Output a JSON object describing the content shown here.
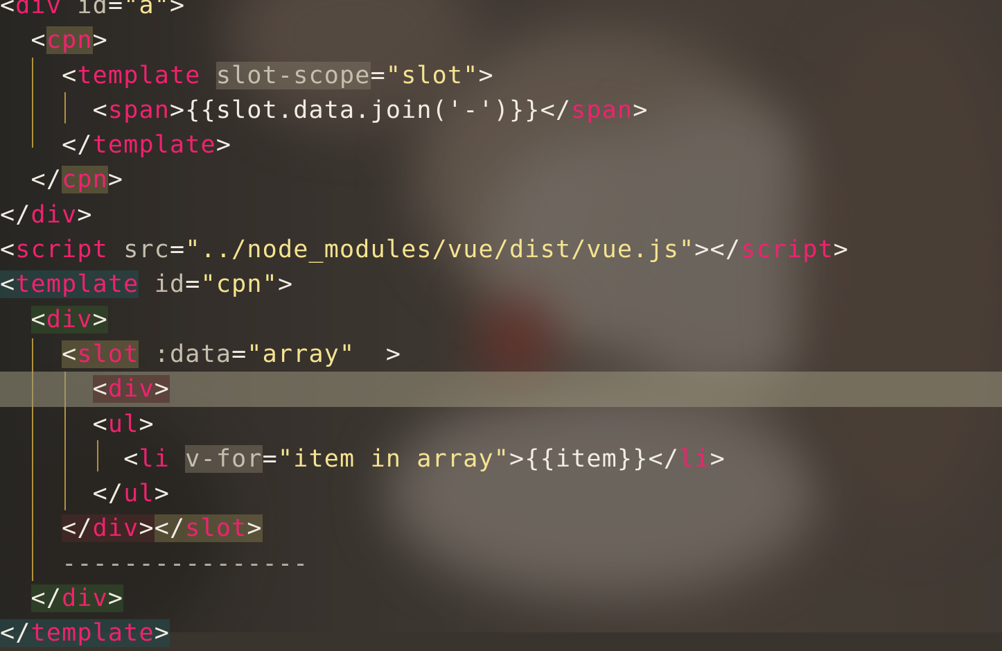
{
  "code_lines": [
    {
      "indent": "",
      "parts": [
        [
          "t",
          "<"
        ],
        [
          "tg",
          "div"
        ],
        [
          "t",
          " "
        ],
        [
          "at",
          "id"
        ],
        [
          "t",
          "="
        ],
        [
          "st",
          "\"a\""
        ],
        [
          "t",
          ">"
        ]
      ]
    },
    {
      "indent": "  ",
      "parts": [
        [
          "t",
          "<"
        ],
        [
          "tg hl-y",
          "cpn"
        ],
        [
          "t",
          ">"
        ]
      ]
    },
    {
      "indent": "    ",
      "parts": [
        [
          "t",
          "<"
        ],
        [
          "tg",
          "template"
        ],
        [
          "t",
          " "
        ],
        [
          "at hl-attr",
          "slot-scope"
        ],
        [
          "t",
          "="
        ],
        [
          "st",
          "\"slot\""
        ],
        [
          "t",
          ">"
        ]
      ]
    },
    {
      "indent": "      ",
      "parts": [
        [
          "t",
          "<"
        ],
        [
          "tg",
          "span"
        ],
        [
          "t",
          ">"
        ],
        [
          "tx",
          "{{slot.data.join('-')}}"
        ],
        [
          "t",
          "</"
        ],
        [
          "tg",
          "span"
        ],
        [
          "t",
          ">"
        ]
      ]
    },
    {
      "indent": "    ",
      "parts": [
        [
          "t",
          "</"
        ],
        [
          "tg",
          "template"
        ],
        [
          "t",
          ">"
        ]
      ]
    },
    {
      "indent": "  ",
      "parts": [
        [
          "t",
          "</"
        ],
        [
          "tg hl-y",
          "cpn"
        ],
        [
          "t",
          ">"
        ]
      ]
    },
    {
      "indent": "",
      "parts": [
        [
          "t",
          "</"
        ],
        [
          "tg",
          "div"
        ],
        [
          "t",
          ">"
        ]
      ]
    },
    {
      "indent": "",
      "parts": [
        [
          "t",
          "<"
        ],
        [
          "tg",
          "script"
        ],
        [
          "t",
          " "
        ],
        [
          "at",
          "src"
        ],
        [
          "t",
          "="
        ],
        [
          "st",
          "\"../node_modules/vue/dist/vue.js\""
        ],
        [
          "t",
          "></"
        ],
        [
          "tg",
          "script"
        ],
        [
          "t",
          ">"
        ]
      ]
    },
    {
      "indent": "",
      "parts": [
        [
          "t hl-teal",
          "<"
        ],
        [
          "tg hl-teal",
          "template"
        ],
        [
          "t",
          " "
        ],
        [
          "at",
          "id"
        ],
        [
          "t",
          "="
        ],
        [
          "st",
          "\"cpn\""
        ],
        [
          "t",
          ">"
        ]
      ]
    },
    {
      "indent": "  ",
      "parts": [
        [
          "t hl-green",
          "<"
        ],
        [
          "tg hl-green",
          "div"
        ],
        [
          "t hl-green",
          ">"
        ]
      ]
    },
    {
      "indent": "    ",
      "parts": [
        [
          "t hl-y",
          "<"
        ],
        [
          "tg hl-y",
          "slot"
        ],
        [
          "t",
          " "
        ],
        [
          "at",
          ":data"
        ],
        [
          "t",
          "="
        ],
        [
          "st",
          "\"array\""
        ],
        [
          "t",
          "  >"
        ]
      ]
    },
    {
      "indent": "      ",
      "active": true,
      "parts": [
        [
          "t hl-red",
          "<"
        ],
        [
          "tg hl-red",
          "div"
        ],
        [
          "t hl-red",
          ">"
        ]
      ]
    },
    {
      "indent": "      ",
      "parts": [
        [
          "t",
          "<"
        ],
        [
          "tg",
          "ul"
        ],
        [
          "t",
          ">"
        ]
      ]
    },
    {
      "indent": "        ",
      "parts": [
        [
          "t",
          "<"
        ],
        [
          "tg",
          "li"
        ],
        [
          "t",
          " "
        ],
        [
          "at hl-attr",
          "v-for"
        ],
        [
          "t",
          "="
        ],
        [
          "st",
          "\"item in array\""
        ],
        [
          "t",
          ">"
        ],
        [
          "tx",
          "{{item}}"
        ],
        [
          "t",
          "</"
        ],
        [
          "tg",
          "li"
        ],
        [
          "t",
          ">"
        ]
      ]
    },
    {
      "indent": "      ",
      "parts": [
        [
          "t",
          "</"
        ],
        [
          "tg",
          "ul"
        ],
        [
          "t",
          ">"
        ]
      ]
    },
    {
      "indent": "    ",
      "parts": [
        [
          "t hl-red",
          "</"
        ],
        [
          "tg hl-red",
          "div"
        ],
        [
          "t hl-red",
          ">"
        ],
        [
          "t hl-y",
          "</"
        ],
        [
          "tg hl-y",
          "slot"
        ],
        [
          "t hl-y",
          ">"
        ]
      ]
    },
    {
      "indent": "    ",
      "parts": [
        [
          "dim",
          "----------------"
        ]
      ]
    },
    {
      "indent": "  ",
      "parts": [
        [
          "t hl-green",
          "</"
        ],
        [
          "tg hl-green",
          "div"
        ],
        [
          "t hl-green",
          ">"
        ]
      ]
    },
    {
      "indent": "",
      "parts": [
        [
          "t hl-teal",
          "</"
        ],
        [
          "tg hl-teal",
          "template"
        ],
        [
          "t hl-teal",
          ">"
        ]
      ]
    }
  ],
  "colors": {
    "tag": "#f0226f",
    "attribute": "#c7bfae",
    "string": "#f5e390",
    "text": "#f2ede4",
    "indent_guide": "#c9a441",
    "active_line": "#9b967d"
  }
}
